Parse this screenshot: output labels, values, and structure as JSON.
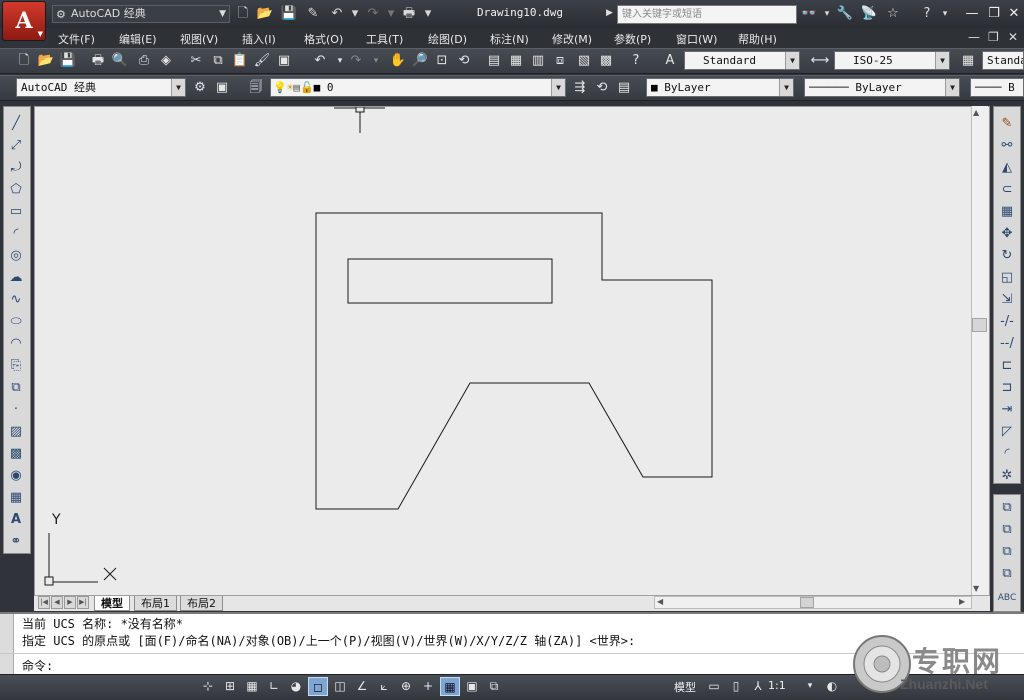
{
  "title_bar": {
    "app_button_letter": "A",
    "workspace": "AutoCAD 经典",
    "document_name": "Drawing10.dwg",
    "search_placeholder": "键入关键字或短语"
  },
  "menu": {
    "items": [
      "文件(F)",
      "编辑(E)",
      "视图(V)",
      "插入(I)",
      "格式(O)",
      "工具(T)",
      "绘图(D)",
      "标注(N)",
      "修改(M)",
      "参数(P)",
      "窗口(W)",
      "帮助(H)"
    ]
  },
  "styles_toolbar": {
    "text_style": "Standard",
    "dim_style": "ISO-25",
    "table_style": "Standa"
  },
  "workspace_toolbar": {
    "workspace": "AutoCAD 经典"
  },
  "layers_toolbar": {
    "current_layer": "0"
  },
  "properties_toolbar": {
    "color": "ByLayer",
    "linetype": "ByLayer",
    "lineweight": "B"
  },
  "ucs": {
    "y_label": "Y",
    "x_label": "X"
  },
  "layout_tabs": [
    "模型",
    "布局1",
    "布局2"
  ],
  "command_window": {
    "history": [
      "当前 UCS 名称: *没有名称*",
      "指定 UCS 的原点或 [面(F)/命名(NA)/对象(OB)/上一个(P)/视图(V)/世界(W)/X/Y/Z/Z 轴(ZA)] <世界>:"
    ],
    "prompt": "命令:"
  },
  "status_bar": {
    "model_label": "模型",
    "annotation_scale": "1:1"
  },
  "watermark": {
    "title": "专职网",
    "url": "Zhuanzhi.Net"
  }
}
